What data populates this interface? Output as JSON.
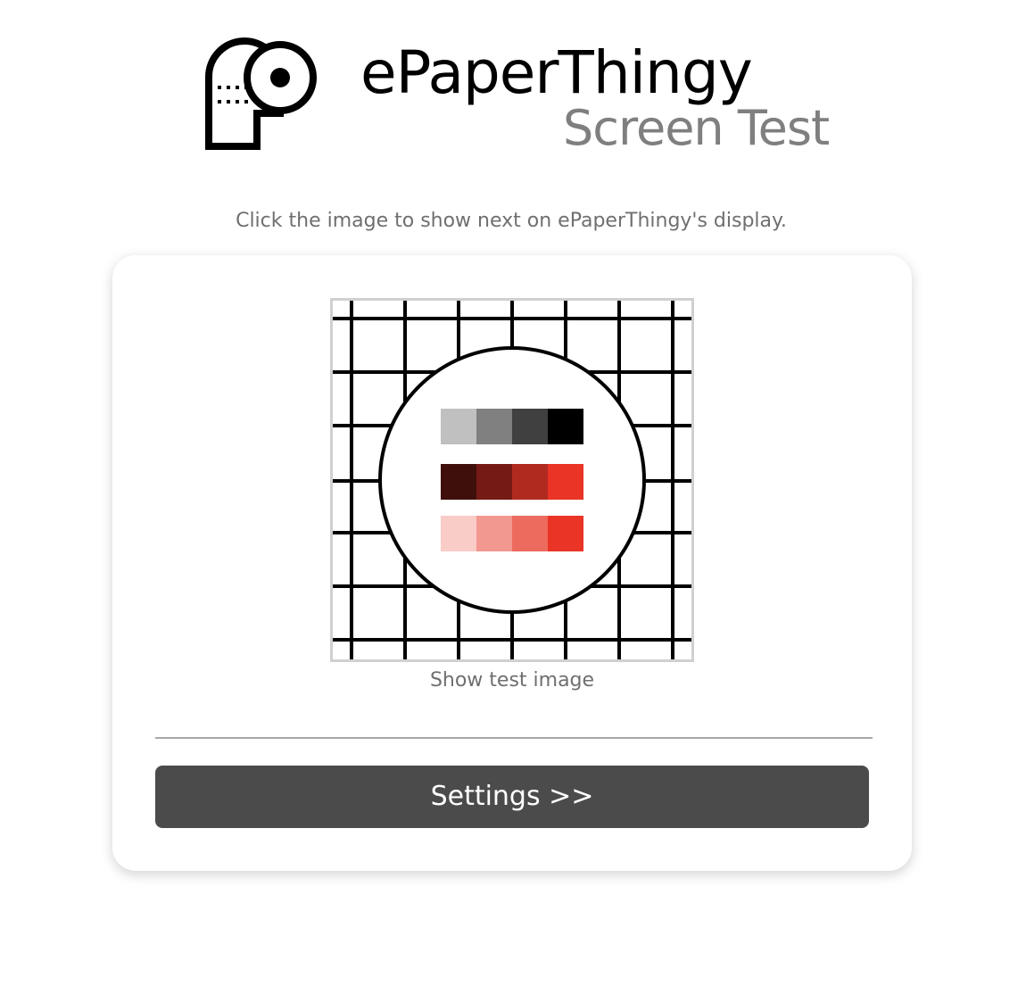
{
  "header": {
    "title": "ePaperThingy",
    "subtitle": "Screen Test",
    "logo_icon": "epaperthingy-logo-icon"
  },
  "instruction": "Click the image to show next on ePaperThingy's display.",
  "test_image": {
    "caption": "Show test image",
    "swatches": [
      [
        "#c0c0c0",
        "#808080",
        "#404040",
        "#000000"
      ],
      [
        "#3f0f0c",
        "#761a15",
        "#b02a20",
        "#e93426"
      ],
      [
        "#f9ccc8",
        "#f39890",
        "#ed6a5e",
        "#e93426"
      ]
    ]
  },
  "settings": {
    "label": "Settings >>"
  },
  "colors": {
    "button_bg": "#4b4b4b",
    "muted_text": "#7f7f7f",
    "card_bg": "#ffffff"
  }
}
